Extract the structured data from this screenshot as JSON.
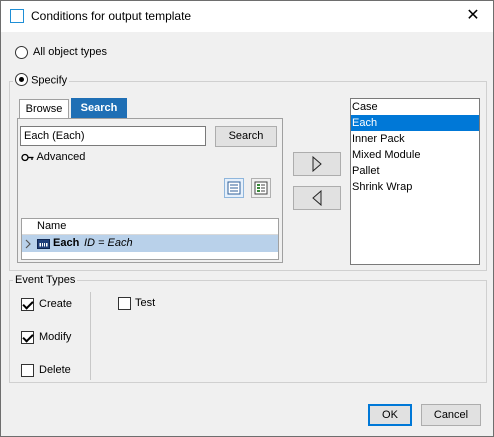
{
  "window": {
    "title": "Conditions for output template",
    "close_glyph": "✕"
  },
  "scope": {
    "all_label": "All object types",
    "specify_label": "Specify",
    "selected": "Specify"
  },
  "tabs": [
    {
      "label": "Browse",
      "active": false
    },
    {
      "label": "Search",
      "active": true
    }
  ],
  "search": {
    "query": "Each (Each)",
    "button_label": "Search",
    "advanced_label": "Advanced"
  },
  "results": {
    "column_name": "Name",
    "rows": [
      {
        "name": "Each",
        "detail": "ID = Each",
        "selected": true
      }
    ]
  },
  "move_buttons": {
    "add_icon": "arrow-right-icon",
    "remove_icon": "arrow-left-icon"
  },
  "object_types": {
    "items": [
      "Case",
      "Each",
      "Inner Pack",
      "Mixed Module",
      "Pallet",
      "Shrink Wrap"
    ],
    "selected": "Each"
  },
  "event_types": {
    "caption": "Event Types",
    "items": [
      {
        "label": "Create",
        "checked": true
      },
      {
        "label": "Modify",
        "checked": true
      },
      {
        "label": "Delete",
        "checked": false
      },
      {
        "label": "Test",
        "checked": false
      }
    ]
  },
  "footer": {
    "ok_label": "OK",
    "cancel_label": "Cancel"
  },
  "colors": {
    "accent": "#0078d7",
    "tab_active": "#1f6fb5",
    "row_highlight": "#b9d1ea"
  }
}
